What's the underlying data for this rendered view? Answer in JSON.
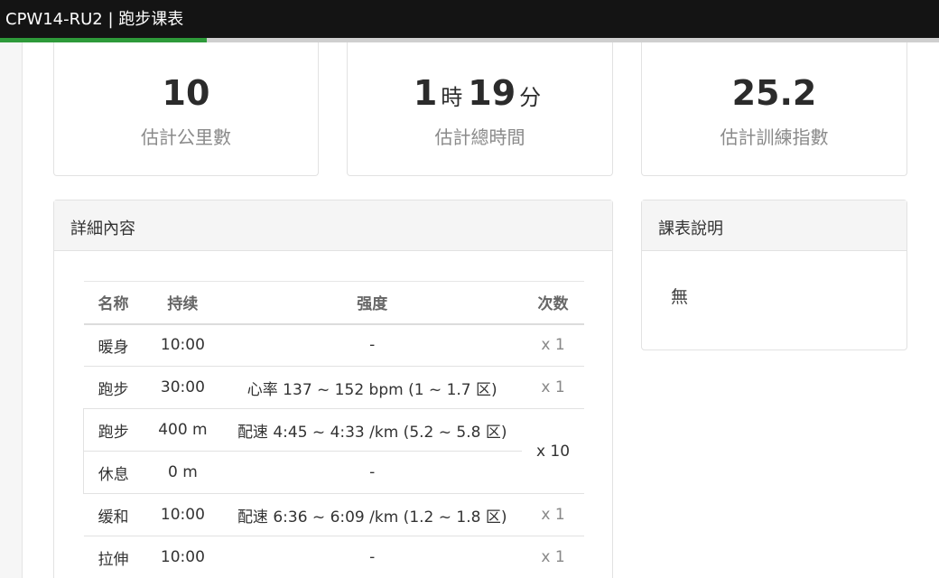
{
  "window": {
    "title": "CPW14-RU2 | 跑步课表"
  },
  "progress": {
    "fraction": 0.22
  },
  "stats": {
    "distance": {
      "value": "10",
      "label": "估計公里數"
    },
    "duration": {
      "hours": "1",
      "hours_unit": "時",
      "minutes": "19",
      "minutes_unit": "分",
      "label": "估計總時間"
    },
    "training_index": {
      "value": "25.2",
      "label": "估計訓練指數"
    }
  },
  "details": {
    "title": "詳細內容",
    "columns": [
      "名称",
      "持续",
      "强度",
      "次数"
    ],
    "rows": [
      {
        "name": "暖身",
        "duration": "10:00",
        "intensity": "-",
        "reps": "x 1"
      },
      {
        "name": "跑步",
        "duration": "30:00",
        "intensity": "心率 137 ~ 152 bpm (1 ~ 1.7 区)",
        "reps": "x 1"
      },
      {
        "name": "跑步",
        "duration": "400 m",
        "intensity": "配速 4:45 ~ 4:33 /km (5.2 ~ 5.8 区)",
        "reps": "x 10"
      },
      {
        "name": "休息",
        "duration": "0 m",
        "intensity": "-"
      },
      {
        "name": "缓和",
        "duration": "10:00",
        "intensity": "配速 6:36 ~ 6:09 /km (1.2 ~ 1.8 区)",
        "reps": "x 1"
      },
      {
        "name": "拉伸",
        "duration": "10:00",
        "intensity": "-",
        "reps": "x 1"
      }
    ]
  },
  "description": {
    "title": "課表說明",
    "text": "無"
  }
}
